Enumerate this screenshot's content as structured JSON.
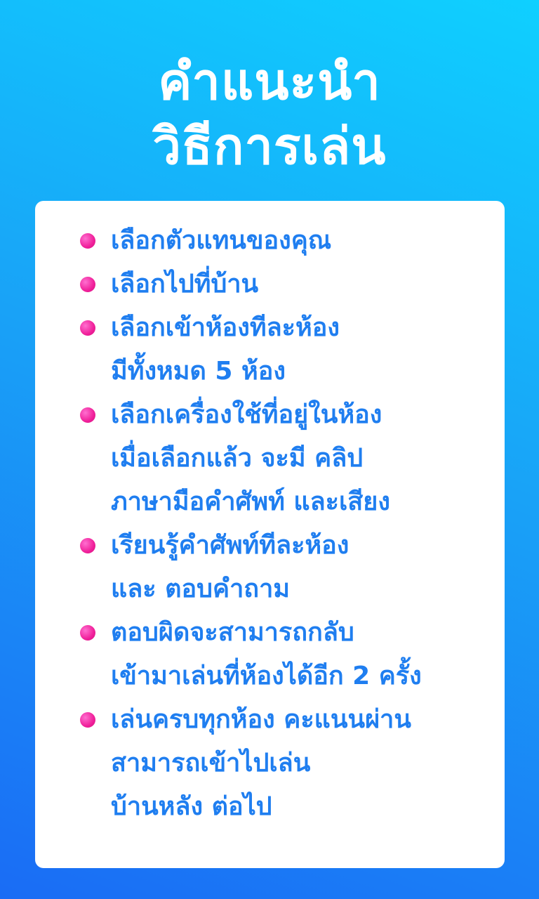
{
  "title": {
    "line1": "คำแนะนำ",
    "line2": "วิธีการเล่น"
  },
  "instructions": [
    {
      "lines": [
        "เลือกตัวแทนของคุณ"
      ]
    },
    {
      "lines": [
        "เลือกไปที่บ้าน"
      ]
    },
    {
      "lines": [
        "เลือกเข้าห้องทีละห้อง",
        "มีทั้งหมด 5 ห้อง"
      ]
    },
    {
      "lines": [
        "เลือกเครื่องใช้ที่อยู่ในห้อง",
        "เมื่อเลือกแล้ว จะมี คลิป",
        "ภาษามือคำศัพท์ และเสียง"
      ]
    },
    {
      "lines": [
        "เรียนรู้คำศัพท์ทีละห้อง",
        "และ ตอบคำถาม"
      ]
    },
    {
      "lines": [
        "ตอบผิดจะสามารถกลับ",
        "เข้ามาเล่นที่ห้องได้อีก 2 ครั้ง"
      ]
    },
    {
      "lines": [
        "เล่นครบทุกห้อง คะแนนผ่าน",
        "สามารถเข้าไปเล่น",
        "บ้านหลัง ต่อไป"
      ]
    }
  ],
  "colors": {
    "background_top": "#0fd0ff",
    "background_bottom": "#1a6cf5",
    "title_text": "#ffffff",
    "card_background": "#ffffff",
    "instruction_text": "#1f7ef0",
    "bullet": "#f0209a"
  },
  "icons": {
    "bullet": "pink-dot-icon"
  }
}
